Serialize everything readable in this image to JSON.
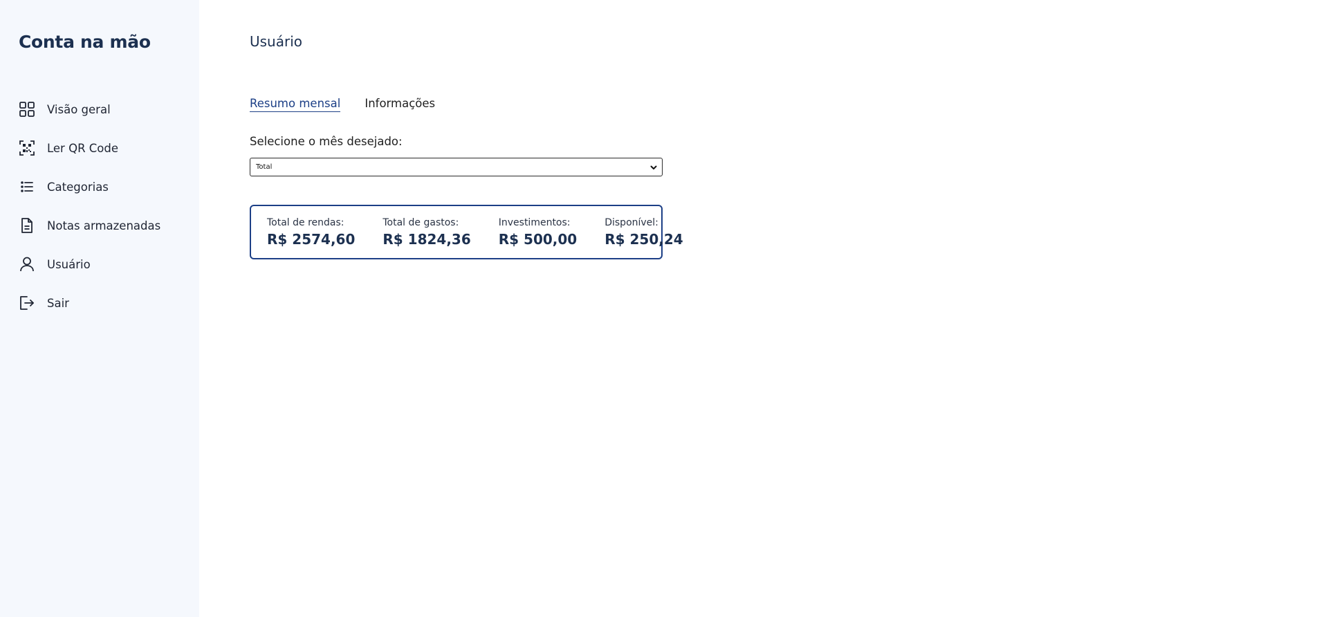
{
  "brand": {
    "name": "Conta na mão"
  },
  "sidebar": {
    "items": [
      {
        "label": "Visão geral",
        "icon": "grid-icon"
      },
      {
        "label": "Ler QR Code",
        "icon": "qr-code-icon"
      },
      {
        "label": "Categorias",
        "icon": "list-icon"
      },
      {
        "label": "Notas armazenadas",
        "icon": "document-icon"
      },
      {
        "label": "Usuário",
        "icon": "user-icon"
      },
      {
        "label": "Sair",
        "icon": "logout-icon"
      }
    ]
  },
  "main": {
    "title": "Usuário",
    "tabs": [
      {
        "label": "Resumo mensal",
        "active": true
      },
      {
        "label": "Informações",
        "active": false
      }
    ],
    "month_select": {
      "label": "Selecione o mês desejado:",
      "value": "Total"
    },
    "summary": {
      "items": [
        {
          "label": "Total de rendas:",
          "value": "R$ 2574,60"
        },
        {
          "label": "Total de gastos:",
          "value": "R$ 1824,36"
        },
        {
          "label": "Investimentos:",
          "value": "R$ 500,00"
        },
        {
          "label": "Disponível:",
          "value": "R$ 250,24"
        }
      ]
    }
  },
  "colors": {
    "sidebar_bg": "#f5f8fd",
    "brand_text": "#1c3050",
    "accent": "#1c3f86"
  }
}
